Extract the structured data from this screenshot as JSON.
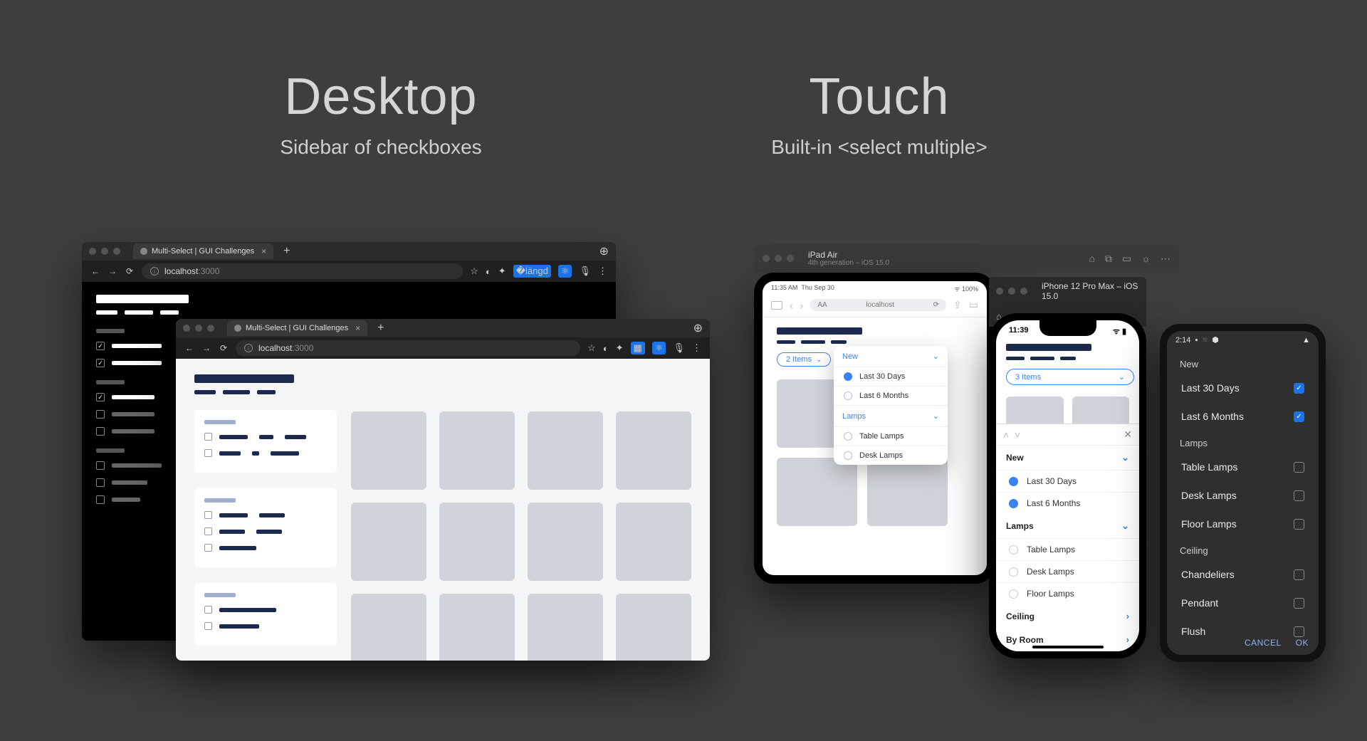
{
  "headings": {
    "desktop": {
      "title": "Desktop",
      "subtitle": "Sidebar of checkboxes"
    },
    "touch": {
      "title": "Touch",
      "subtitle": "Built-in <select multiple>"
    }
  },
  "browser": {
    "tab_title": "Multi-Select | GUI Challenges",
    "url_host": "localhost",
    "url_port": ":3000"
  },
  "ipad_sim": {
    "device": "iPad Air",
    "subtitle": "4th generation – iOS 15.0",
    "status_time": "11:35 AM",
    "status_date": "Thu Sep 30",
    "url_label_left": "AA",
    "url_text": "localhost",
    "chip_label": "2 Items",
    "popover": {
      "sections": [
        {
          "title": "New",
          "options": [
            {
              "label": "Last 30 Days",
              "selected": true
            },
            {
              "label": "Last 6 Months",
              "selected": false
            }
          ]
        },
        {
          "title": "Lamps",
          "options": [
            {
              "label": "Table Lamps",
              "selected": false
            },
            {
              "label": "Desk Lamps",
              "selected": false
            }
          ]
        }
      ]
    }
  },
  "iphone_sim": {
    "titlebar": "iPhone 12 Pro Max – iOS 15.0",
    "status_time": "11:39",
    "chip_label": "3 Items",
    "sheet": {
      "sections": [
        {
          "title": "New",
          "chevron": "down",
          "options": [
            {
              "label": "Last 30 Days",
              "selected": true
            },
            {
              "label": "Last 6 Months",
              "selected": true
            }
          ]
        },
        {
          "title": "Lamps",
          "chevron": "down",
          "options": [
            {
              "label": "Table Lamps",
              "selected": false
            },
            {
              "label": "Desk Lamps",
              "selected": false
            },
            {
              "label": "Floor Lamps",
              "selected": false
            }
          ]
        },
        {
          "title": "Ceiling",
          "chevron": "right",
          "options": []
        },
        {
          "title": "By Room",
          "chevron": "right",
          "options": []
        }
      ]
    }
  },
  "android": {
    "status_time": "2:14",
    "groups": [
      {
        "title": "New",
        "items": [
          {
            "label": "Last 30 Days",
            "checked": true
          },
          {
            "label": "Last 6 Months",
            "checked": true
          }
        ]
      },
      {
        "title": "Lamps",
        "items": [
          {
            "label": "Table Lamps",
            "checked": false
          },
          {
            "label": "Desk Lamps",
            "checked": false
          },
          {
            "label": "Floor Lamps",
            "checked": false
          }
        ]
      },
      {
        "title": "Ceiling",
        "items": [
          {
            "label": "Chandeliers",
            "checked": false
          },
          {
            "label": "Pendant",
            "checked": false
          },
          {
            "label": "Flush",
            "checked": false
          }
        ]
      }
    ],
    "actions": {
      "cancel": "CANCEL",
      "ok": "OK"
    }
  }
}
